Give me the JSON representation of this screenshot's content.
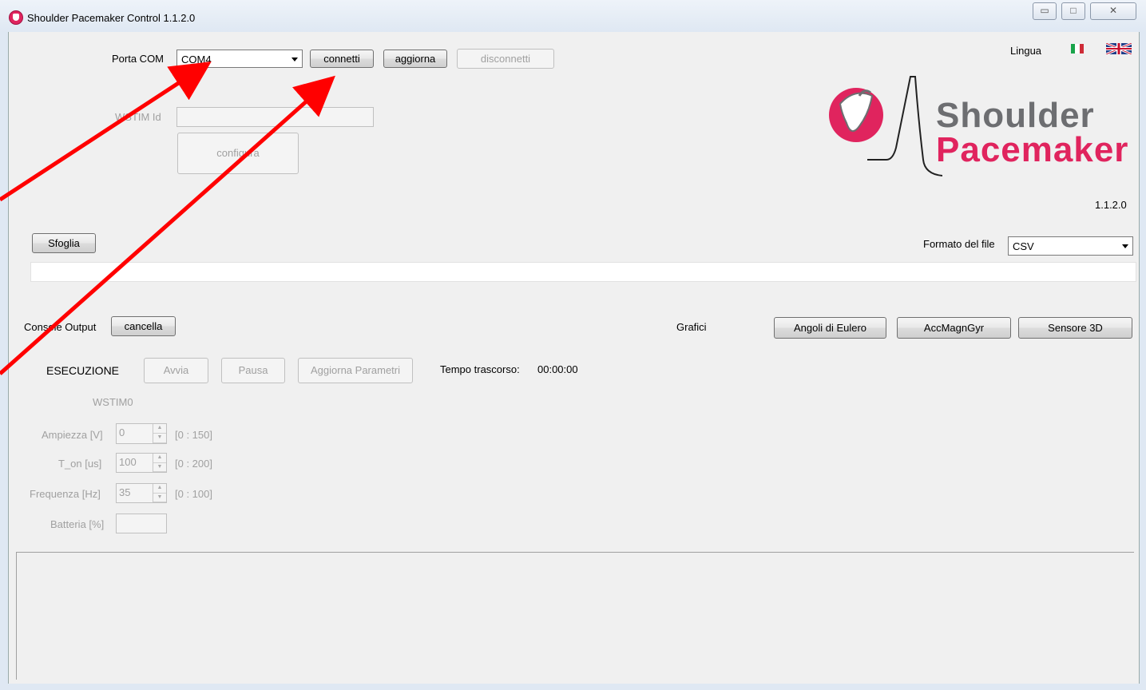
{
  "window": {
    "title": "Shoulder Pacemaker Control 1.1.2.0",
    "minimize": "▭",
    "maximize": "□",
    "close": "✕"
  },
  "com": {
    "label": "Porta COM",
    "port_value": "COM4",
    "connect": "connetti",
    "refresh": "aggiorna",
    "disconnect": "disconnetti"
  },
  "wstim": {
    "id_label": "WSTIM Id",
    "configure": "configura"
  },
  "language": {
    "label": "Lingua"
  },
  "logo": {
    "line1": "Shoulder",
    "line2": "Pacemaker",
    "version": "1.1.2.0",
    "colors": {
      "brand": "#e0245e",
      "gray": "#6d6e71"
    }
  },
  "file": {
    "browse": "Sfoglia",
    "format_label": "Formato del file",
    "format_value": "CSV",
    "path": ""
  },
  "console": {
    "label": "Console Output",
    "clear": "cancella"
  },
  "charts": {
    "label": "Grafici",
    "euler": "Angoli di Eulero",
    "accmag": "AccMagnGyr",
    "sensor3d": "Sensore 3D"
  },
  "execution": {
    "label": "ESECUZIONE",
    "start": "Avvia",
    "pause": "Pausa",
    "update_params": "Aggiorna Parametri",
    "elapsed_label": "Tempo trascorso:",
    "elapsed_value": "00:00:00",
    "device": "WSTIM0"
  },
  "params": {
    "amplitude": {
      "label": "Ampiezza [V]",
      "value": "0",
      "range": "[0 : 150]"
    },
    "t_on": {
      "label": "T_on [us]",
      "value": "100",
      "range": "[0 : 200]"
    },
    "frequency": {
      "label": "Frequenza [Hz]",
      "value": "35",
      "range": "[0 : 100]"
    },
    "battery": {
      "label": "Batteria [%]",
      "value": ""
    }
  }
}
